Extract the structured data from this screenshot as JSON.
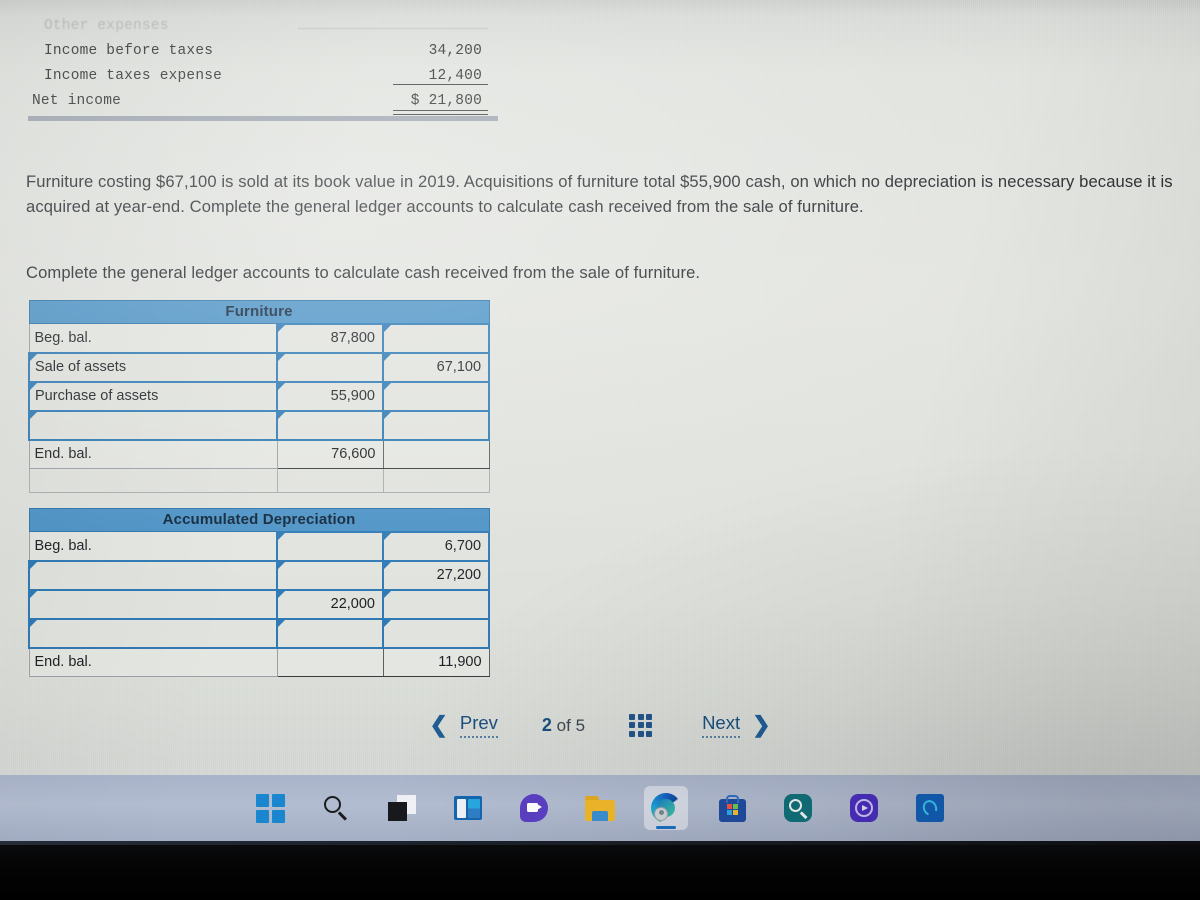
{
  "statement": {
    "faded_row": {
      "label": "Other expenses",
      "col1": "",
      "col2": ""
    },
    "rows": [
      {
        "label": "Income before taxes",
        "col1": "",
        "col2": "34,200"
      },
      {
        "label": "Income taxes expense",
        "col1": "",
        "col2": "12,400"
      },
      {
        "label": "Net income",
        "col1": "",
        "col2": "$ 21,800"
      }
    ]
  },
  "prose": {
    "paragraph1": "Furniture costing $67,100 is sold at its book value in 2019. Acquisitions of furniture total $55,900 cash, on which no depreciation is necessary because it is acquired at year-end. Complete the general ledger accounts to calculate cash received from the sale of furniture.",
    "paragraph2": "Complete the general ledger accounts to calculate cash received from the sale of furniture."
  },
  "ledgers": [
    {
      "title": "Furniture",
      "rows": [
        {
          "desc": "Beg. bal.",
          "desc_edit": false,
          "debit": "87,800",
          "debit_edit": true,
          "credit": "",
          "credit_edit": true
        },
        {
          "desc": "Sale of assets",
          "desc_edit": true,
          "debit": "",
          "debit_edit": true,
          "credit": "67,100",
          "credit_edit": true
        },
        {
          "desc": "Purchase of assets",
          "desc_edit": true,
          "debit": "55,900",
          "debit_edit": true,
          "credit": "",
          "credit_edit": true
        },
        {
          "desc": "",
          "desc_edit": true,
          "debit": "",
          "debit_edit": true,
          "credit": "",
          "credit_edit": true
        }
      ],
      "total": {
        "desc": "End. bal.",
        "debit": "76,600",
        "credit": ""
      }
    },
    {
      "title": "Accumulated Depreciation",
      "rows": [
        {
          "desc": "Beg. bal.",
          "desc_edit": false,
          "debit": "",
          "debit_edit": true,
          "credit": "6,700",
          "credit_edit": true
        },
        {
          "desc": "",
          "desc_edit": true,
          "debit": "",
          "debit_edit": true,
          "credit": "27,200",
          "credit_edit": true
        },
        {
          "desc": "",
          "desc_edit": true,
          "debit": "22,000",
          "debit_edit": true,
          "credit": "",
          "credit_edit": true
        },
        {
          "desc": "",
          "desc_edit": true,
          "debit": "",
          "debit_edit": true,
          "credit": "",
          "credit_edit": true
        }
      ],
      "total": {
        "desc": "End. bal.",
        "debit": "",
        "credit": "11,900"
      }
    }
  ],
  "pager": {
    "prev_label": "Prev",
    "next_label": "Next",
    "current_page": "2",
    "of_label": "of",
    "total_pages": "5",
    "grid_icon": "grid-3x3-icon"
  },
  "taskbar": {
    "items": [
      {
        "name": "start-icon",
        "label": "Start",
        "active": false
      },
      {
        "name": "search-icon",
        "label": "Search",
        "active": false
      },
      {
        "name": "task-view-icon",
        "label": "Task View",
        "active": false
      },
      {
        "name": "widgets-icon",
        "label": "Widgets",
        "active": false
      },
      {
        "name": "teams-chat-icon",
        "label": "Chat",
        "active": false
      },
      {
        "name": "file-explorer-icon",
        "label": "File Explorer",
        "active": false
      },
      {
        "name": "edge-browser-icon",
        "label": "Microsoft Edge",
        "active": true
      },
      {
        "name": "microsoft-store-icon",
        "label": "Microsoft Store",
        "active": false
      },
      {
        "name": "teal-search-app-icon",
        "label": "Search App",
        "active": false
      },
      {
        "name": "purple-sync-app-icon",
        "label": "Sync App",
        "active": false
      },
      {
        "name": "blue-assistant-icon",
        "label": "Assistant",
        "active": false
      }
    ]
  },
  "colors": {
    "accent_blue": "#4c93c6",
    "edit_border": "#2f7ab5",
    "link_blue": "#1b4f7d",
    "page_bg": "#e2e4df",
    "taskbar_bg": "#aeb8cd"
  }
}
